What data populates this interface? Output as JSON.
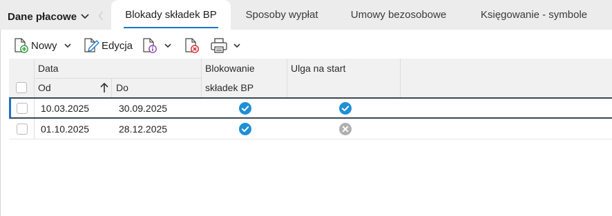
{
  "header": {
    "section_title": "Dane płacowe",
    "tabs": [
      {
        "label": "Blokady składek BP",
        "active": true
      },
      {
        "label": "Sposoby wypłat",
        "active": false
      },
      {
        "label": "Umowy bezosobowe",
        "active": false
      },
      {
        "label": "Księgowanie - symbole",
        "active": false
      }
    ]
  },
  "toolbar": {
    "new_label": "Nowy",
    "edit_label": "Edycja"
  },
  "table": {
    "group_header": "Data",
    "col_from": "Od",
    "col_to": "Do",
    "col_block_line1": "Blokowanie",
    "col_block_line2": "składek BP",
    "col_relief": "Ulga na start",
    "sort_direction": "ascending",
    "rows": [
      {
        "from": "10.03.2025",
        "to": "30.09.2025",
        "blokowanie": true,
        "ulga": true,
        "selected": true
      },
      {
        "from": "01.10.2025",
        "to": "28.12.2025",
        "blokowanie": true,
        "ulga": false,
        "selected": false
      }
    ]
  },
  "colors": {
    "accent": "#1a73c9",
    "check_on": "#1f8fd6",
    "check_off": "#b0b0b0"
  }
}
